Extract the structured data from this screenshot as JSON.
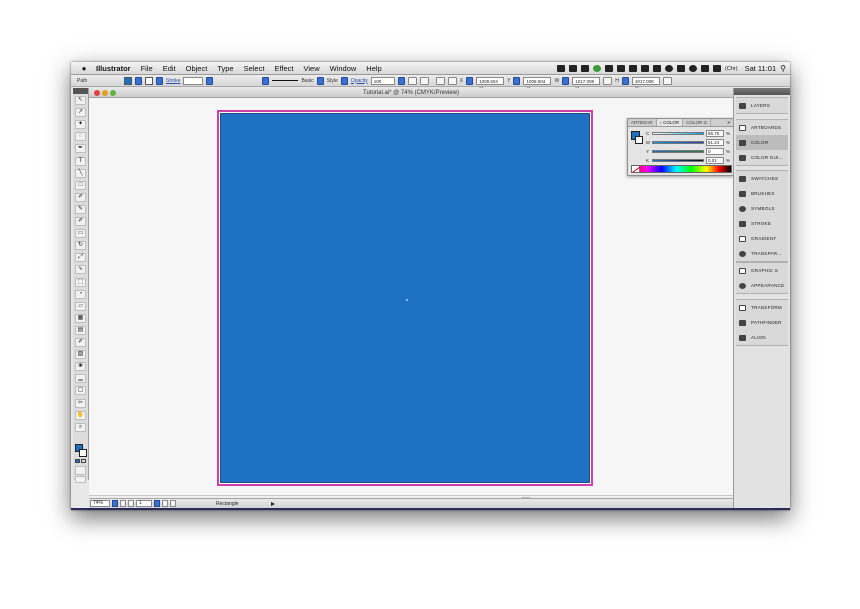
{
  "menubar": {
    "apple": "",
    "items": [
      "Illustrator",
      "File",
      "Edit",
      "Object",
      "Type",
      "Select",
      "Effect",
      "View",
      "Window",
      "Help"
    ],
    "battery": "(Chr)",
    "clock": "Sat 11:01",
    "search_icon": "magnifier-icon"
  },
  "controlbar": {
    "object_type": "Path",
    "stroke_label": "Stroke",
    "basic_label": "Basic",
    "style_label": "Style",
    "opacity_label": "Opacity",
    "opacity_value": "100",
    "x_label": "X",
    "x_value": "1008.504 pt",
    "y_label": "Y",
    "y_value": "1008.504 pt",
    "w_label": "W",
    "w_value": "1017.008 pt",
    "h_label": "H",
    "h_value": "1017.008 pt"
  },
  "document": {
    "title": "Tutorial.ai* @ 74% (CMYK/Preview)"
  },
  "statusbar": {
    "zoom": "74%",
    "artboard_number": "1",
    "current_tool": "Rectangle"
  },
  "color_panel": {
    "tabs": [
      "ARTBOAR",
      "↕ COLOR",
      "COLOR G"
    ],
    "menu_label": "»",
    "rows": [
      {
        "letter": "C",
        "value": "86.75",
        "pct": "%"
      },
      {
        "letter": "M",
        "value": "51.24",
        "pct": "%"
      },
      {
        "letter": "Y",
        "value": "0",
        "pct": "%"
      },
      {
        "letter": "K",
        "value": "0.01",
        "pct": "%"
      }
    ]
  },
  "dock": {
    "group1": [
      "LAYERS"
    ],
    "group2": [
      "ARTBOARDS",
      "COLOR",
      "COLOR GUI..."
    ],
    "group3": [
      "SWATCHES",
      "BRUSHES",
      "SYMBOLS",
      "STROKE",
      "GRADIENT",
      "TRANSPAR..."
    ],
    "group4": [
      "GRAPHIC S",
      "APPEARANCE"
    ],
    "group5": [
      "TRANSFORM",
      "PATHFINDER",
      "ALIGN"
    ]
  },
  "colors": {
    "fill": "#1f72c3",
    "artboard_border": "#cc3fa8",
    "accent": "#3b6fd1"
  }
}
